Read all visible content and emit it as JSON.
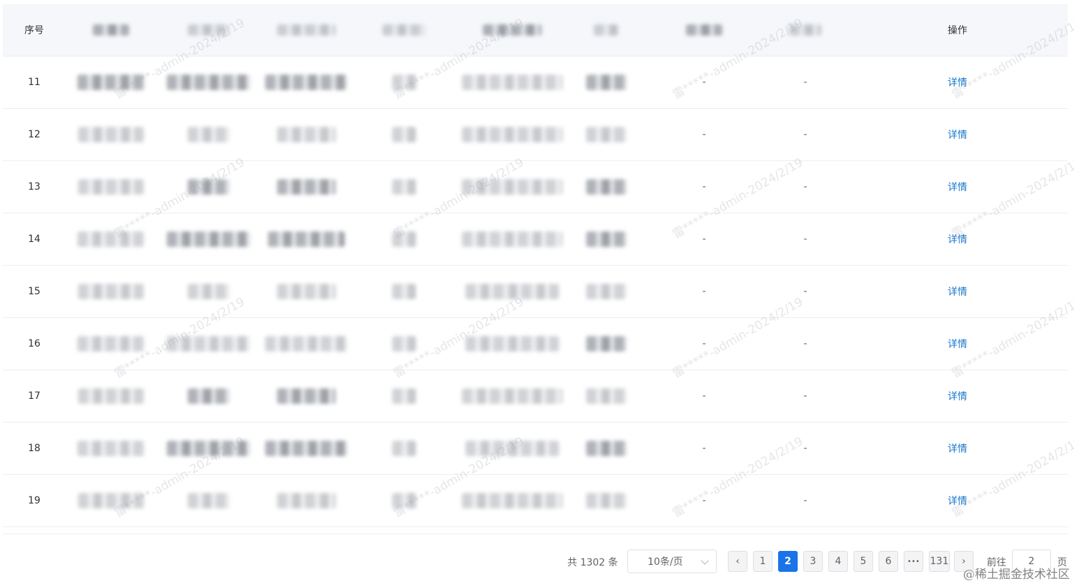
{
  "table": {
    "headers": [
      "序号",
      "",
      "",
      "",
      "",
      "",
      "",
      "",
      "",
      "操作"
    ],
    "rows": [
      {
        "index": "11",
        "col7": "-",
        "col8": "-",
        "action": "详情"
      },
      {
        "index": "12",
        "col7": "-",
        "col8": "-",
        "action": "详情"
      },
      {
        "index": "13",
        "col7": "-",
        "col8": "-",
        "action": "详情"
      },
      {
        "index": "14",
        "col7": "-",
        "col8": "-",
        "action": "详情"
      },
      {
        "index": "15",
        "col7": "-",
        "col8": "-",
        "action": "详情"
      },
      {
        "index": "16",
        "col7": "-",
        "col8": "-",
        "action": "详情"
      },
      {
        "index": "17",
        "col7": "-",
        "col8": "-",
        "action": "详情"
      },
      {
        "index": "18",
        "col7": "-",
        "col8": "-",
        "action": "详情"
      },
      {
        "index": "19",
        "col7": "-",
        "col8": "-",
        "action": "详情"
      }
    ]
  },
  "pagination": {
    "total_text": "共 1302 条",
    "page_size": "10条/页",
    "prev_label": "‹",
    "next_label": "›",
    "pages": [
      "1",
      "2",
      "3",
      "4",
      "5",
      "6",
      "•••",
      "131"
    ],
    "current_page": "2",
    "goto_label": "前往",
    "goto_value": "2",
    "goto_suffix": "页"
  },
  "watermark": {
    "text": "雷*****-admin-2024/2/19"
  },
  "credit": "@稀土掘金技术社区"
}
